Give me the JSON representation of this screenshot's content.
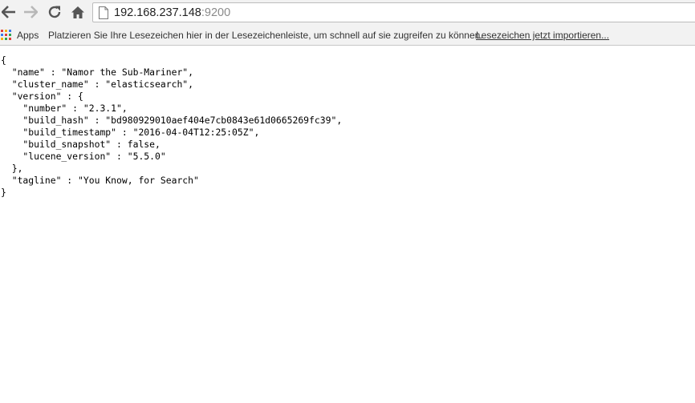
{
  "browser": {
    "address_bar": {
      "host": "192.168.237.148",
      "port": ":9200"
    },
    "icons": {
      "back": "arrow-left-icon",
      "forward": "arrow-right-icon",
      "reload": "reload-icon",
      "home": "home-icon",
      "page": "page-icon",
      "apps": "apps-grid-icon"
    },
    "colors": {
      "toolbar_bg": "#f2f2f2",
      "nav_enabled": "#555555",
      "nav_disabled": "#b8b8b8"
    }
  },
  "bookmarks_bar": {
    "apps_label": "Apps",
    "hint": "Platzieren Sie Ihre Lesezeichen hier in der Lesezeichenleiste, um schnell auf sie zugreifen zu können.",
    "import_link": "Lesezeichen jetzt importieren..."
  },
  "page": {
    "lines": [
      "{",
      "  \"name\" : \"Namor the Sub-Mariner\",",
      "  \"cluster_name\" : \"elasticsearch\",",
      "  \"version\" : {",
      "    \"number\" : \"2.3.1\",",
      "    \"build_hash\" : \"bd980929010aef404e7cb0843e61d0665269fc39\",",
      "    \"build_timestamp\" : \"2016-04-04T12:25:05Z\",",
      "    \"build_snapshot\" : false,",
      "    \"lucene_version\" : \"5.5.0\"",
      "  },",
      "  \"tagline\" : \"You Know, for Search\"",
      "}"
    ]
  }
}
